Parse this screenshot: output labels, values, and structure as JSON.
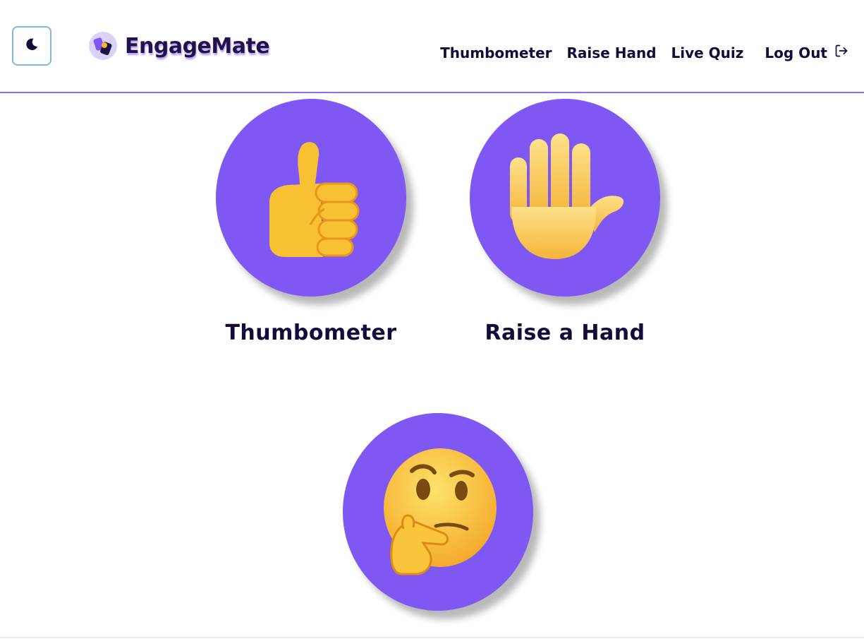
{
  "header": {
    "theme_toggle_icon": "moon-icon",
    "brand_name": "EngageMate",
    "brand_logo_icon": "engagemate-logo-icon"
  },
  "nav": {
    "items": [
      {
        "label": "Thumbometer"
      },
      {
        "label": "Raise Hand"
      },
      {
        "label": "Live Quiz"
      }
    ],
    "logout": {
      "label": "Log Out",
      "icon": "log-out-icon"
    }
  },
  "cards": [
    {
      "label": "Thumbometer",
      "icon": "thumbs-up-icon"
    },
    {
      "label": "Raise a Hand",
      "icon": "raised-hand-icon"
    },
    {
      "label": "",
      "icon": "thinking-face-icon"
    }
  ],
  "colors": {
    "accent": "#7f57f2",
    "text": "#150a3a",
    "header_rule": "#8a6cf0"
  }
}
